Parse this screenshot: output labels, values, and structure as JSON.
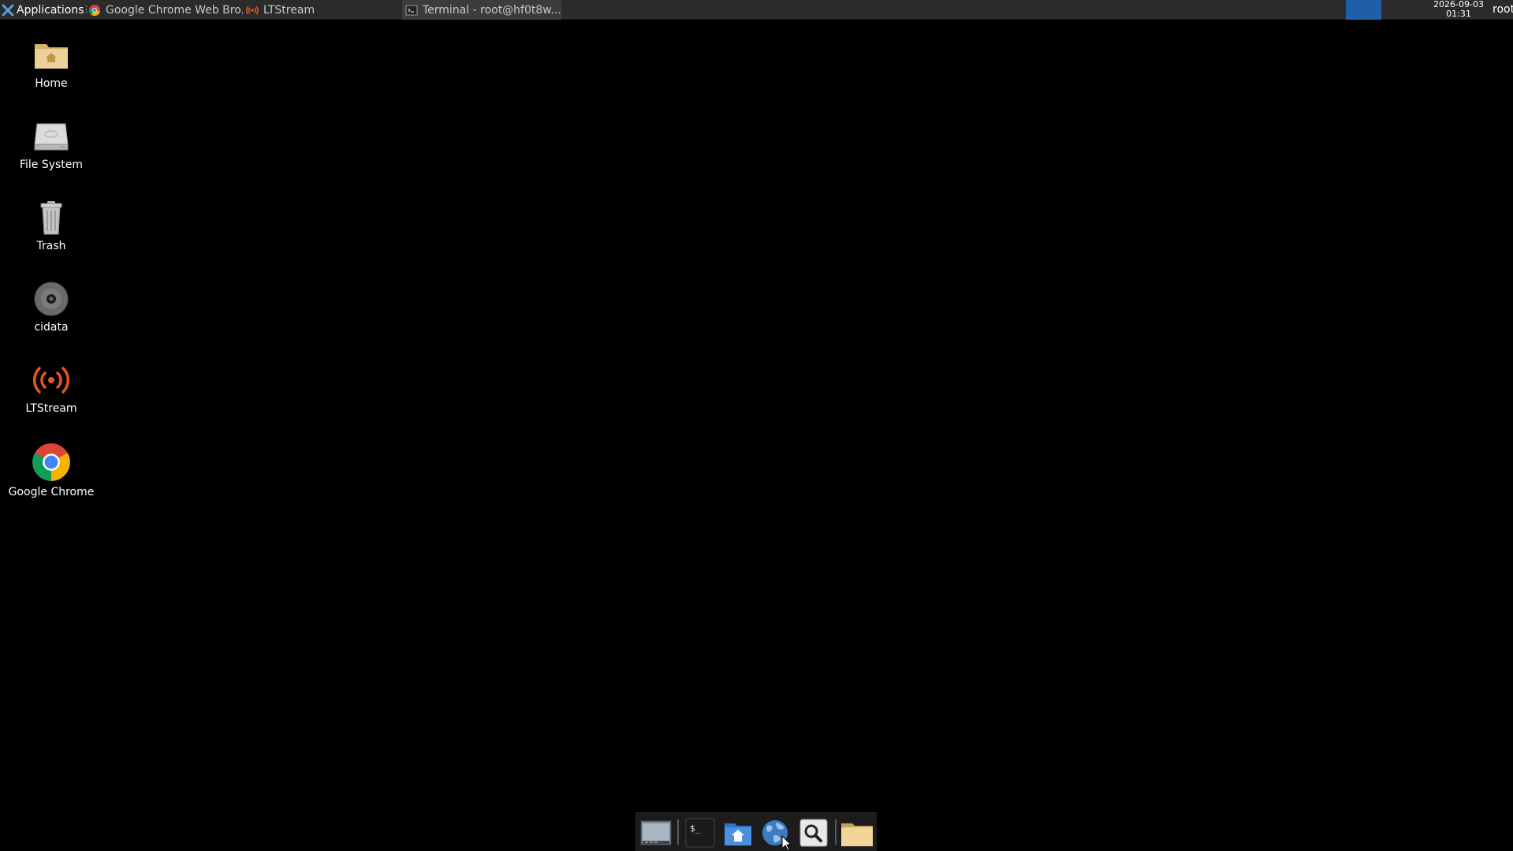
{
  "panel": {
    "applications_label": "Applications",
    "tasks": [
      {
        "label": "Google Chrome Web Bro...",
        "icon": "chrome-icon"
      },
      {
        "label": "LTStream",
        "icon": "ltstream-icon"
      },
      {
        "label": "Terminal - root@hf0t8w...",
        "icon": "terminal-icon"
      }
    ],
    "clock_date": "2026-09-03",
    "clock_time": "01:31",
    "user": "root"
  },
  "desktop": {
    "icons": [
      {
        "label": "Home",
        "icon": "home-folder-icon"
      },
      {
        "label": "File System",
        "icon": "drive-icon"
      },
      {
        "label": "Trash",
        "icon": "trash-icon"
      },
      {
        "label": "cidata",
        "icon": "disc-icon"
      },
      {
        "label": "LTStream",
        "icon": "broadcast-icon"
      },
      {
        "label": "Google Chrome",
        "icon": "chrome-icon"
      }
    ]
  },
  "dock": {
    "items": [
      {
        "name": "show-desktop",
        "icon": "show-desktop-icon"
      },
      {
        "name": "terminal",
        "icon": "terminal-icon"
      },
      {
        "name": "home-folder",
        "icon": "home-folder-icon"
      },
      {
        "name": "web-browser",
        "icon": "globe-icon"
      },
      {
        "name": "app-finder",
        "icon": "search-icon"
      },
      {
        "name": "files",
        "icon": "folder-icon"
      }
    ]
  },
  "colors": {
    "desktop_bg": "#000000",
    "panel_bg": "#2b2b2b",
    "panel_accent": "#1f5fa8",
    "ltstream_orange": "#e8541e"
  }
}
